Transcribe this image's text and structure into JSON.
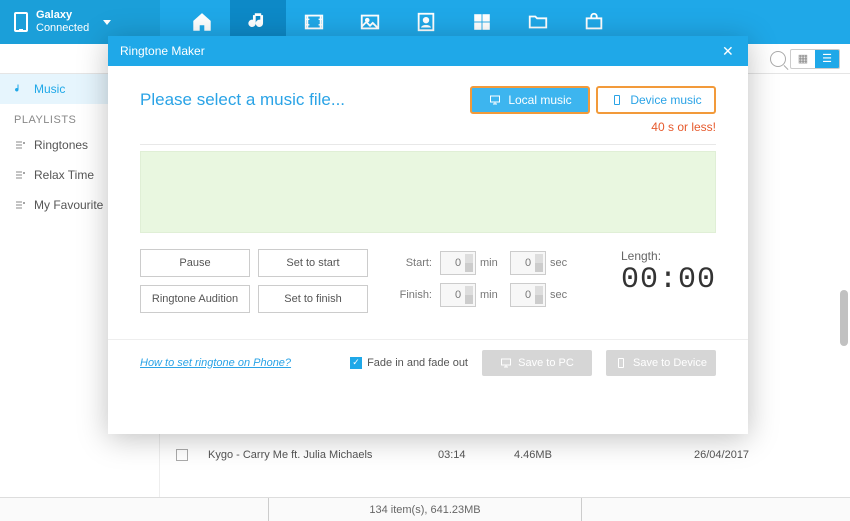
{
  "device": {
    "name": "Galaxy",
    "status": "Connected"
  },
  "sidebar": {
    "music_label": "Music",
    "playlists_heading": "PLAYLISTS",
    "items": [
      "Ringtones",
      "Relax Time",
      "My Favourite"
    ]
  },
  "table": {
    "row": {
      "name": "Kygo - Carry Me ft. Julia Michaels",
      "duration": "03:14",
      "size": "4.46MB",
      "date": "26/04/2017"
    }
  },
  "status": {
    "summary": "134 item(s), 641.23MB"
  },
  "modal": {
    "title": "Ringtone Maker",
    "prompt": "Please select a music file...",
    "local_btn": "Local music",
    "device_btn": "Device music",
    "limit": "40 s or less!",
    "buttons": {
      "pause": "Pause",
      "set_start": "Set to start",
      "audition": "Ringtone Audition",
      "set_finish": "Set to finish"
    },
    "time": {
      "start_label": "Start:",
      "finish_label": "Finish:",
      "min_unit": "min",
      "sec_unit": "sec",
      "start_min": "0",
      "start_sec": "0",
      "finish_min": "0",
      "finish_sec": "0"
    },
    "length_label": "Length:",
    "length_value": "00:00",
    "help_link": "How to set ringtone on Phone?",
    "fade_label": "Fade in and fade out",
    "save_pc": "Save to PC",
    "save_device": "Save to Device"
  }
}
